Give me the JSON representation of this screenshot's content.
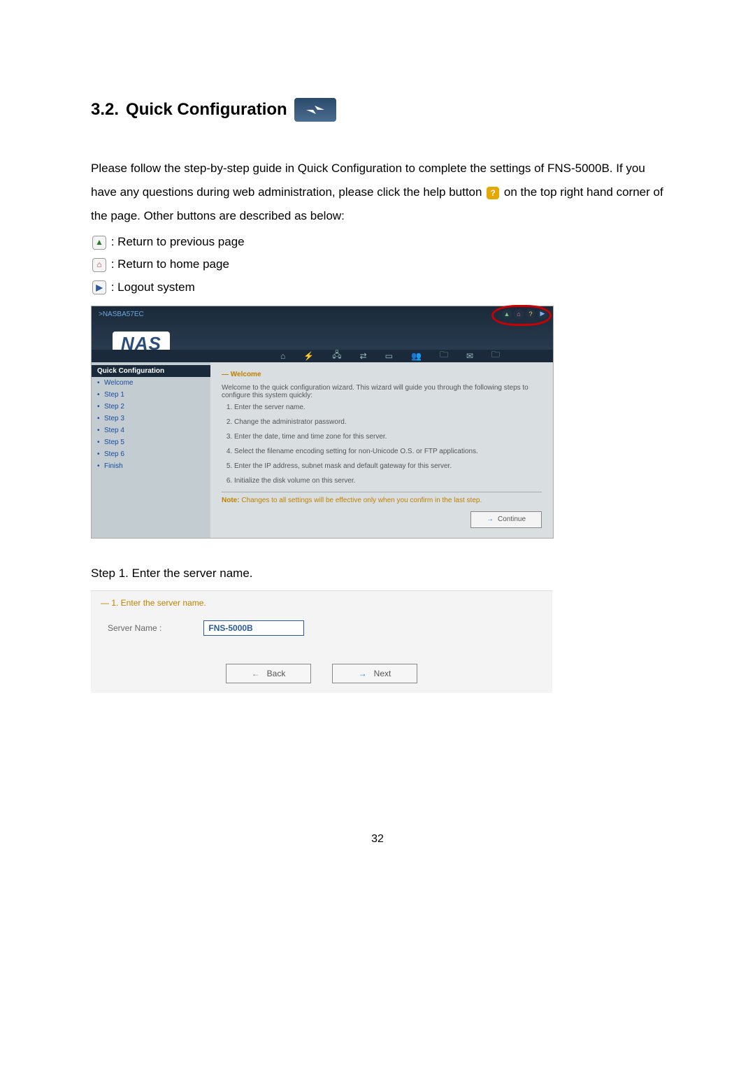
{
  "section": {
    "number": "3.2.",
    "title": "Quick Configuration"
  },
  "intro": {
    "p1": "Please follow the step-by-step guide in Quick Configuration to complete the settings of FNS-5000B.  If you have any questions during web administration, please click the help button ",
    "p1b": " on the top right hand corner of the page.  Other buttons are described as below:",
    "icons": {
      "back_label": ": Return to previous page",
      "home_label": ": Return to home page",
      "logout_label": ": Logout system"
    }
  },
  "screenshot1": {
    "hostname": ">NASBA57EC",
    "logo": "NAS",
    "sidebar_title": "Quick Configuration",
    "sidebar_items": [
      "Welcome",
      "Step 1",
      "Step 2",
      "Step 3",
      "Step 4",
      "Step 5",
      "Step 6",
      "Finish"
    ],
    "content_title": "— Welcome",
    "content_intro": "Welcome to the quick configuration wizard. This wizard will guide you through the following steps to configure this system quickly:",
    "steps": [
      "Enter the server name.",
      "Change the administrator password.",
      "Enter the date, time and time zone for this server.",
      "Select the filename encoding setting for non-Unicode O.S. or FTP applications.",
      "Enter the IP address, subnet mask and default gateway for this server.",
      "Initialize the disk volume on this server."
    ],
    "note_prefix": "Note:",
    "note_text": " Changes to all settings will be effective only when you confirm in the last step.",
    "continue_label": "Continue"
  },
  "step1": {
    "caption": "Step 1.   Enter the server name.",
    "panel_title": "— 1. Enter the server name.",
    "field_label": "Server Name :",
    "field_value": "FNS-5000B",
    "back_label": "Back",
    "next_label": "Next"
  },
  "page_number": "32"
}
